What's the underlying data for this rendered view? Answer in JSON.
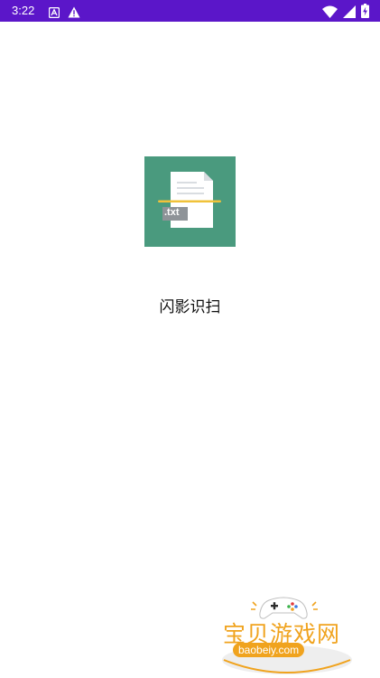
{
  "status_bar": {
    "time": "3:22",
    "left_icons": [
      "font-a-icon",
      "alert-triangle-icon"
    ],
    "right_icons": [
      "wifi-icon",
      "cell-signal-icon",
      "battery-charging-icon"
    ],
    "background": "#5b16c9"
  },
  "splash": {
    "logo_icon": "txt-document-scan-icon",
    "logo_badge_text": ".txt",
    "logo_background": "#4a9a7e",
    "app_name": "闪影识扫"
  },
  "watermark": {
    "title": "宝贝游戏网",
    "url": "baobeiy.com",
    "accent": "#f0a31e"
  }
}
